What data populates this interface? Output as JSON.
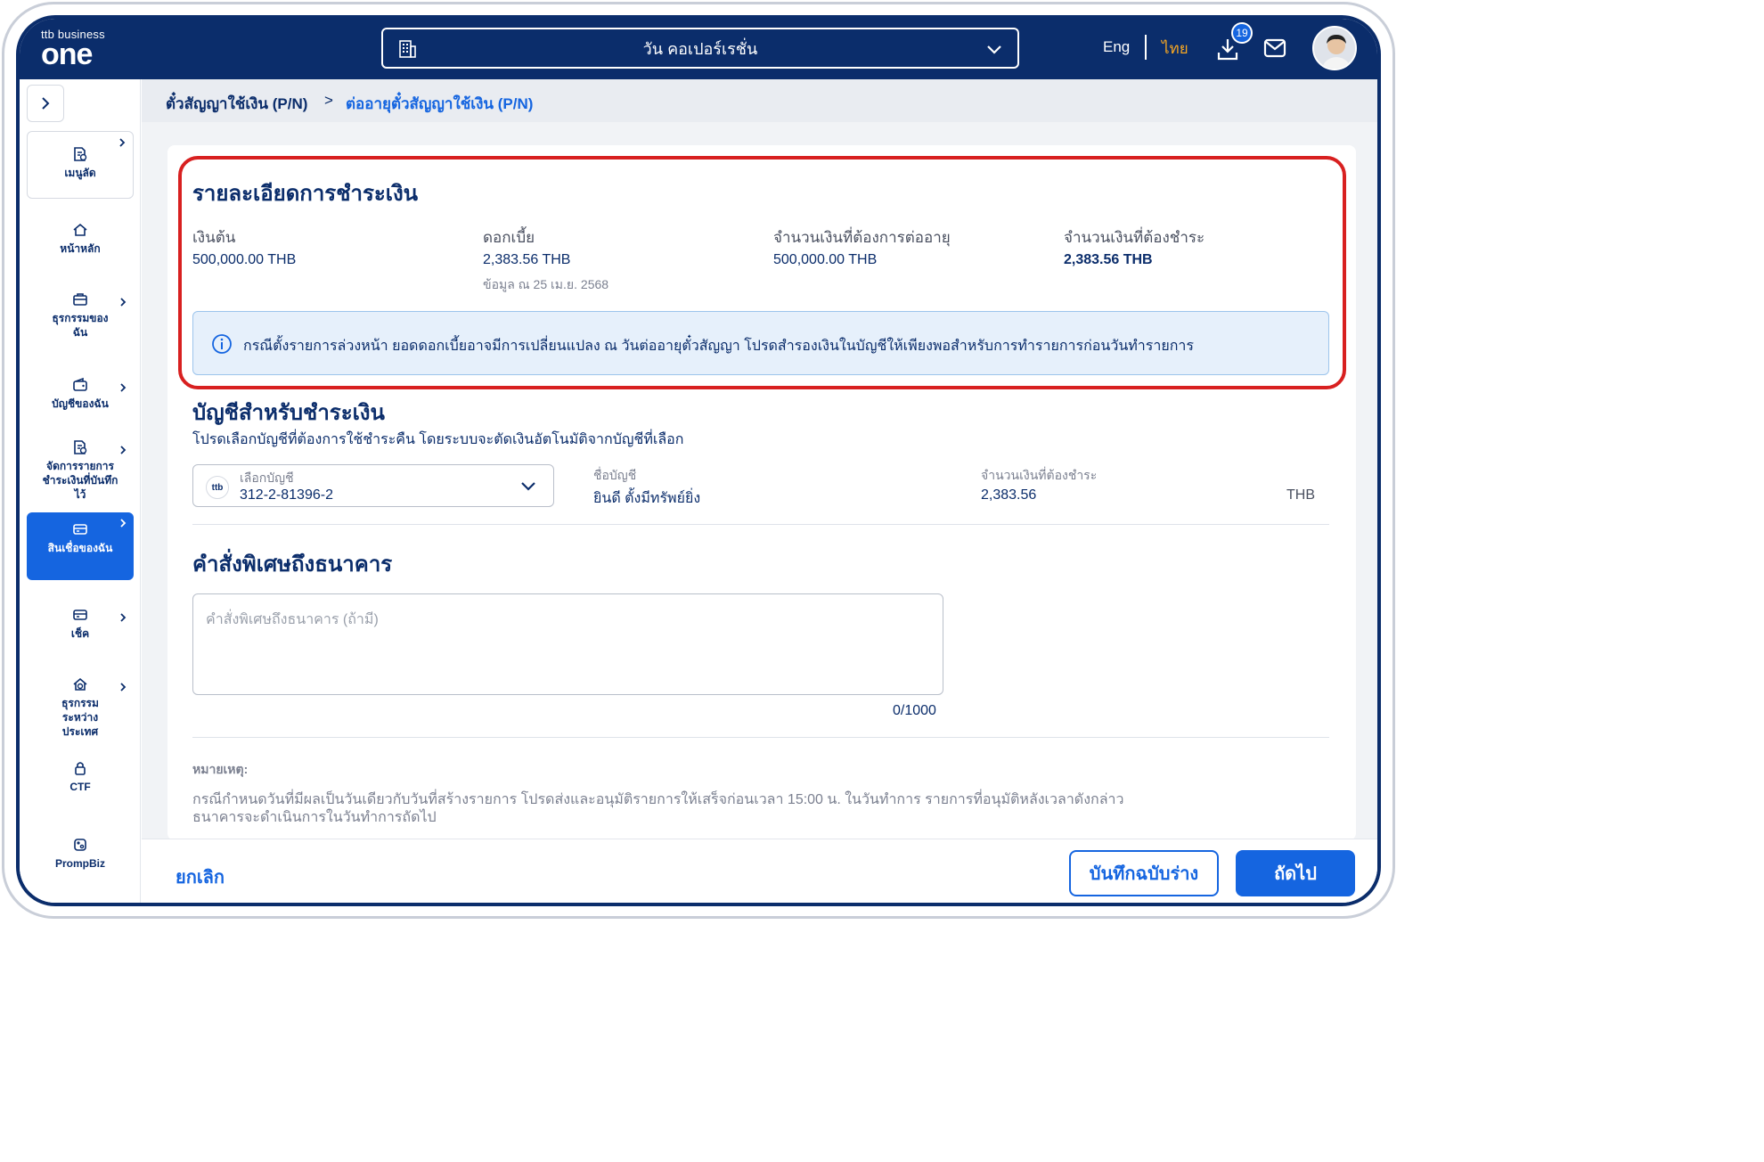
{
  "header": {
    "brand_small": "ttb business",
    "brand_big": "one",
    "company": "วัน คอเปอร์เรชั่น",
    "lang_en": "Eng",
    "lang_th": "ไทย",
    "download_badge": "19",
    "icons": [
      "building-icon",
      "chevron-down-icon",
      "download-icon",
      "mail-icon",
      "avatar"
    ]
  },
  "sidebar": {
    "items": [
      {
        "label": "เมนูลัด",
        "icon": "shortcut-icon"
      },
      {
        "label": "หน้าหลัก",
        "icon": "home-icon"
      },
      {
        "label": "ธุรกรรมของฉัน",
        "icon": "briefcase-icon"
      },
      {
        "label": "บัญชีของฉัน",
        "icon": "wallet-icon"
      },
      {
        "label": "จัดการรายการชำระเงินที่บันทึกไว้",
        "icon": "saved-payment-icon"
      },
      {
        "label": "สินเชื่อของฉัน",
        "icon": "loan-icon"
      },
      {
        "label": "เช็ค",
        "icon": "cheque-icon"
      },
      {
        "label": "ธุรกรรมระหว่างประเทศ",
        "icon": "international-icon"
      },
      {
        "label": "CTF",
        "icon": "lock-icon"
      },
      {
        "label": "PrompBiz",
        "icon": "prompbiz-icon"
      }
    ]
  },
  "breadcrumb": {
    "first": "ตั๋วสัญญาใช้เงิน (P/N)",
    "separator": ">",
    "current": "ต่ออายุตั๋วสัญญาใช้เงิน (P/N)"
  },
  "payment": {
    "title": "รายละเอียดการชำระเงิน",
    "principal_label": "เงินต้น",
    "principal_value": "500,000.00 THB",
    "interest_label": "ดอกเบี้ย",
    "interest_value": "2,383.56 THB",
    "interest_note": "ข้อมูล ณ 25 เม.ย. 2568",
    "renew_label": "จำนวนเงินที่ต้องการต่ออายุ",
    "renew_value": "500,000.00 THB",
    "due_label": "จำนวนเงินที่ต้องชำระ",
    "due_value": "2,383.56 THB",
    "info": "กรณีตั้งรายการล่วงหน้า ยอดดอกเบี้ยอาจมีการเปลี่ยนแปลง ณ วันต่ออายุตั๋วสัญญา โปรดสำรองเงินในบัญชีให้เพียงพอสำหรับการทำรายการก่อนวันทำรายการ"
  },
  "account": {
    "title": "บัญชีสำหรับชำระเงิน",
    "desc": "โปรดเลือกบัญชีที่ต้องการใช้ชำระคืน โดยระบบจะตัดเงินอัตโนมัติจากบัญชีที่เลือก",
    "select_label": "เลือกบัญชี",
    "select_value": "312-2-81396-2",
    "bank_logo": "ttb",
    "name_label": "ชื่อบัญชี",
    "name_value": "ยินดี ตั้งมีทรัพย์ยิ่ง",
    "amount_label": "จำนวนเงินที่ต้องชำระ",
    "amount_value": "2,383.56",
    "currency": "THB"
  },
  "instruction": {
    "title": "คำสั่งพิเศษถึงธนาคาร",
    "placeholder": "คำสั่งพิเศษถึงธนาคาร (ถ้ามี)",
    "counter": "0/1000"
  },
  "remark": {
    "title": "หมายเหตุ:",
    "line1": "กรณีกำหนดวันที่มีผลเป็นวันเดียวกับวันที่สร้างรายการ โปรดส่งและอนุมัติรายการให้เสร็จก่อนเวลา 15:00 น. ในวันทำการ รายการที่อนุมัติหลังเวลาดังกล่าว",
    "line2": "ธนาคารจะดำเนินการในวันทำการถัดไป"
  },
  "footer": {
    "cancel": "ยกเลิก",
    "save_draft": "บันทึกฉบับร่าง",
    "next": "ถัดไป"
  },
  "colors": {
    "primary_navy": "#0b2d6b",
    "accent_blue": "#1565e0",
    "highlight_red": "#d82020",
    "lang_active": "#f5a623"
  }
}
